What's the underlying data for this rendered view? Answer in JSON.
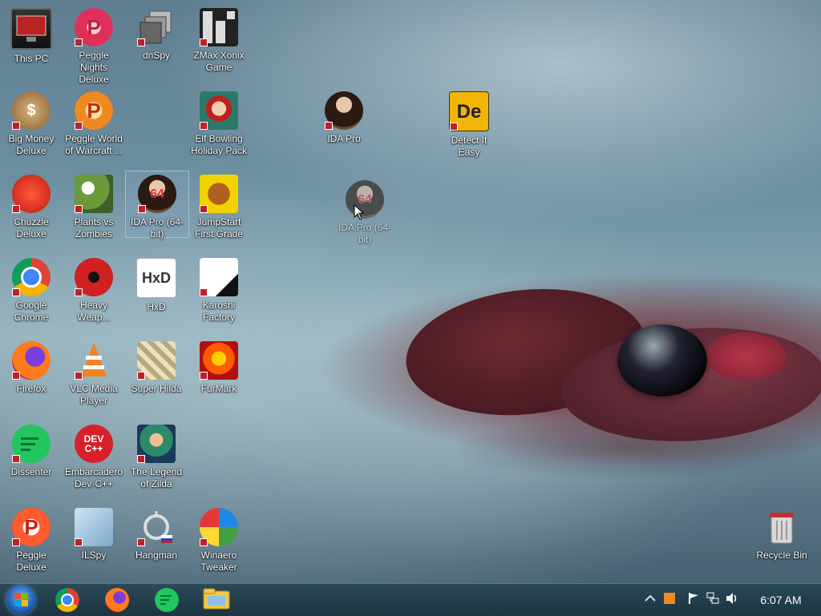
{
  "desktop": {
    "icons": [
      {
        "label": "This PC",
        "icon": "computer-icon"
      },
      {
        "label": "Peggle Nights Deluxe",
        "icon": "peggle-nights-icon"
      },
      {
        "label": "dnSpy",
        "icon": "dnspy-icon"
      },
      {
        "label": "ZMax Xonix Game",
        "icon": "zmax-xonix-icon"
      },
      {
        "label": "Big Money Deluxe",
        "icon": "money-bag-icon"
      },
      {
        "label": "Peggle World of Warcraft ...",
        "icon": "peggle-wow-icon"
      },
      {
        "label": "Elf Bowling Holiday Pack",
        "icon": "elf-bowling-icon"
      },
      {
        "label": "IDA Pro",
        "icon": "ida-pro-icon"
      },
      {
        "label": "Detect It Easy",
        "icon": "detect-it-easy-icon"
      },
      {
        "label": "Chuzzle Deluxe",
        "icon": "chuzzle-icon"
      },
      {
        "label": "Plants vs Zombies",
        "icon": "plants-vs-zombies-icon"
      },
      {
        "label": "IDA Pro (64-bit)",
        "icon": "ida-pro-64-icon"
      },
      {
        "label": "JumpStart First Grade",
        "icon": "jumpstart-icon"
      },
      {
        "label": "IDA Pro (64-bit)",
        "icon": "ida-pro-64-drag-icon"
      },
      {
        "label": "Google Chrome",
        "icon": "chrome-icon"
      },
      {
        "label": "Heavy Weap...",
        "icon": "heavy-weapon-icon"
      },
      {
        "label": "HxD",
        "icon": "hxd-icon"
      },
      {
        "label": "Karoshi Factory",
        "icon": "karoshi-icon"
      },
      {
        "label": "Firefox",
        "icon": "firefox-icon"
      },
      {
        "label": "VLC Media Player",
        "icon": "vlc-icon"
      },
      {
        "label": "Super Hilda",
        "icon": "super-hilda-icon"
      },
      {
        "label": "FurMark",
        "icon": "furmark-icon"
      },
      {
        "label": "Dissenter",
        "icon": "dissenter-icon"
      },
      {
        "label": "Embarcadero Dev-C++",
        "icon": "devcpp-icon"
      },
      {
        "label": "The Legend of Zilda",
        "icon": "zilda-icon"
      },
      {
        "label": "Peggle Deluxe",
        "icon": "peggle-icon"
      },
      {
        "label": "ILSpy",
        "icon": "ilspy-icon"
      },
      {
        "label": "Hangman",
        "icon": "hangman-icon"
      },
      {
        "label": "Winaero Tweaker",
        "icon": "winaero-icon"
      },
      {
        "label": "Recycle Bin",
        "icon": "recycle-bin-icon"
      }
    ],
    "devcpp_text": "DEV\nC++",
    "hxd_text": "HxD",
    "detect_text": "De",
    "ida64_text": "64"
  },
  "taskbar": {
    "apps": [
      "start-icon",
      "chrome-icon",
      "firefox-icon",
      "dissenter-icon",
      "file-explorer-icon"
    ],
    "tray_icons": [
      "show-hidden-icon",
      "app-tray-icon",
      "flag-icon",
      "network-icon",
      "volume-icon"
    ],
    "clock": "6:07 AM"
  },
  "colors": {
    "taskbar": "#1f3f4f",
    "shield": "#c0202a"
  }
}
